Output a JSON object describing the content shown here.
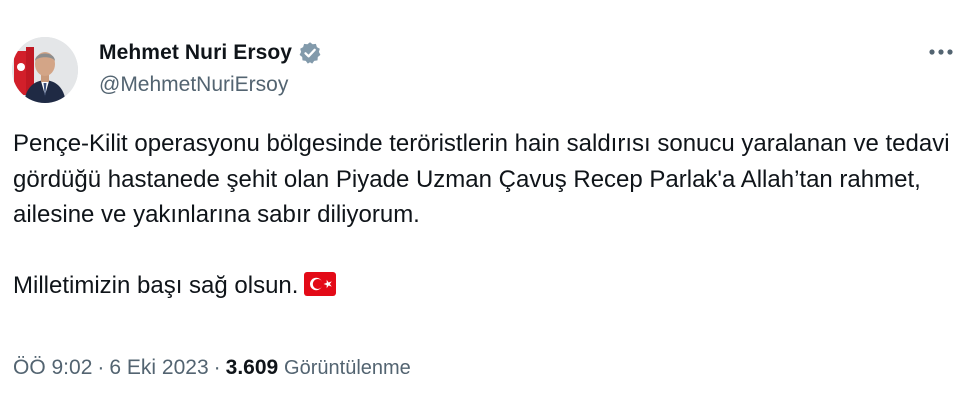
{
  "author": {
    "display_name": "Mehmet Nuri Ersoy",
    "handle": "@MehmetNuriErsoy",
    "verified_icon": "verified-badge-icon",
    "badge_color": "#829aab"
  },
  "tweet": {
    "paragraph_1": "Pençe-Kilit operasyonu bölgesinde teröristlerin hain saldırısı sonucu yaralanan ve tedavi gördüğü hastanede şehit olan Piyade Uzman Çavuş Recep Parlak'a Allah’tan rahmet, ailesine ve yakınlarına sabır diliyorum.",
    "paragraph_2": "Milletimizin başı sağ olsun.",
    "emoji": "turkey-flag-icon"
  },
  "meta": {
    "time": "ÖÖ 9:02",
    "separator": "·",
    "date": "6 Eki 2023",
    "views_count": "3.609",
    "views_label": "Görüntülenme"
  },
  "actions": {
    "more_icon": "more-options-icon"
  },
  "colors": {
    "text_primary": "#0f1419",
    "text_secondary": "#536471",
    "flag_red": "#e30a17"
  }
}
